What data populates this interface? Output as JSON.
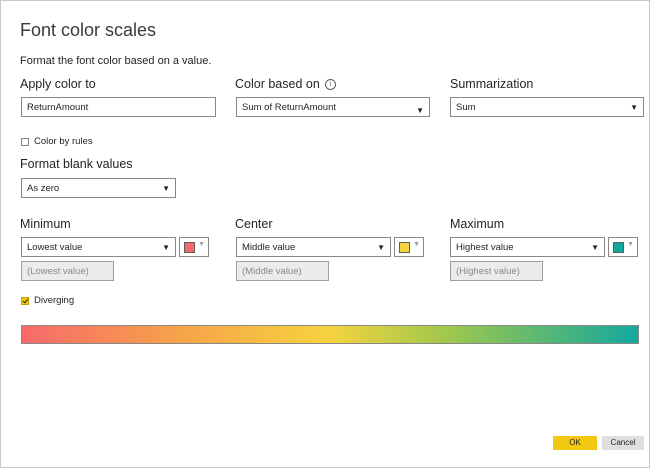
{
  "dialog": {
    "title": "Font color scales",
    "subtitle": "Format the font color based on a value."
  },
  "apply_color_to": {
    "label": "Apply color to",
    "value": "ReturnAmount"
  },
  "color_based_on": {
    "label": "Color based on",
    "info_icon": "i",
    "value": "Sum of ReturnAmount"
  },
  "summarization": {
    "label": "Summarization",
    "value": "Sum"
  },
  "color_by_rules": {
    "label": "Color by rules",
    "checked": false
  },
  "format_blank_values": {
    "label": "Format blank values",
    "value": "As zero"
  },
  "minimum": {
    "label": "Minimum",
    "value": "Lowest value",
    "placeholder": "(Lowest value)",
    "color": "#f8696b"
  },
  "center": {
    "label": "Center",
    "value": "Middle value",
    "placeholder": "(Middle value)",
    "color": "#f5d33f"
  },
  "maximum": {
    "label": "Maximum",
    "value": "Highest value",
    "placeholder": "(Highest value)",
    "color": "#13a89e"
  },
  "diverging": {
    "label": "Diverging",
    "checked": true
  },
  "buttons": {
    "ok": "OK",
    "cancel": "Cancel"
  },
  "theme": {
    "accent": "#f2c811"
  }
}
